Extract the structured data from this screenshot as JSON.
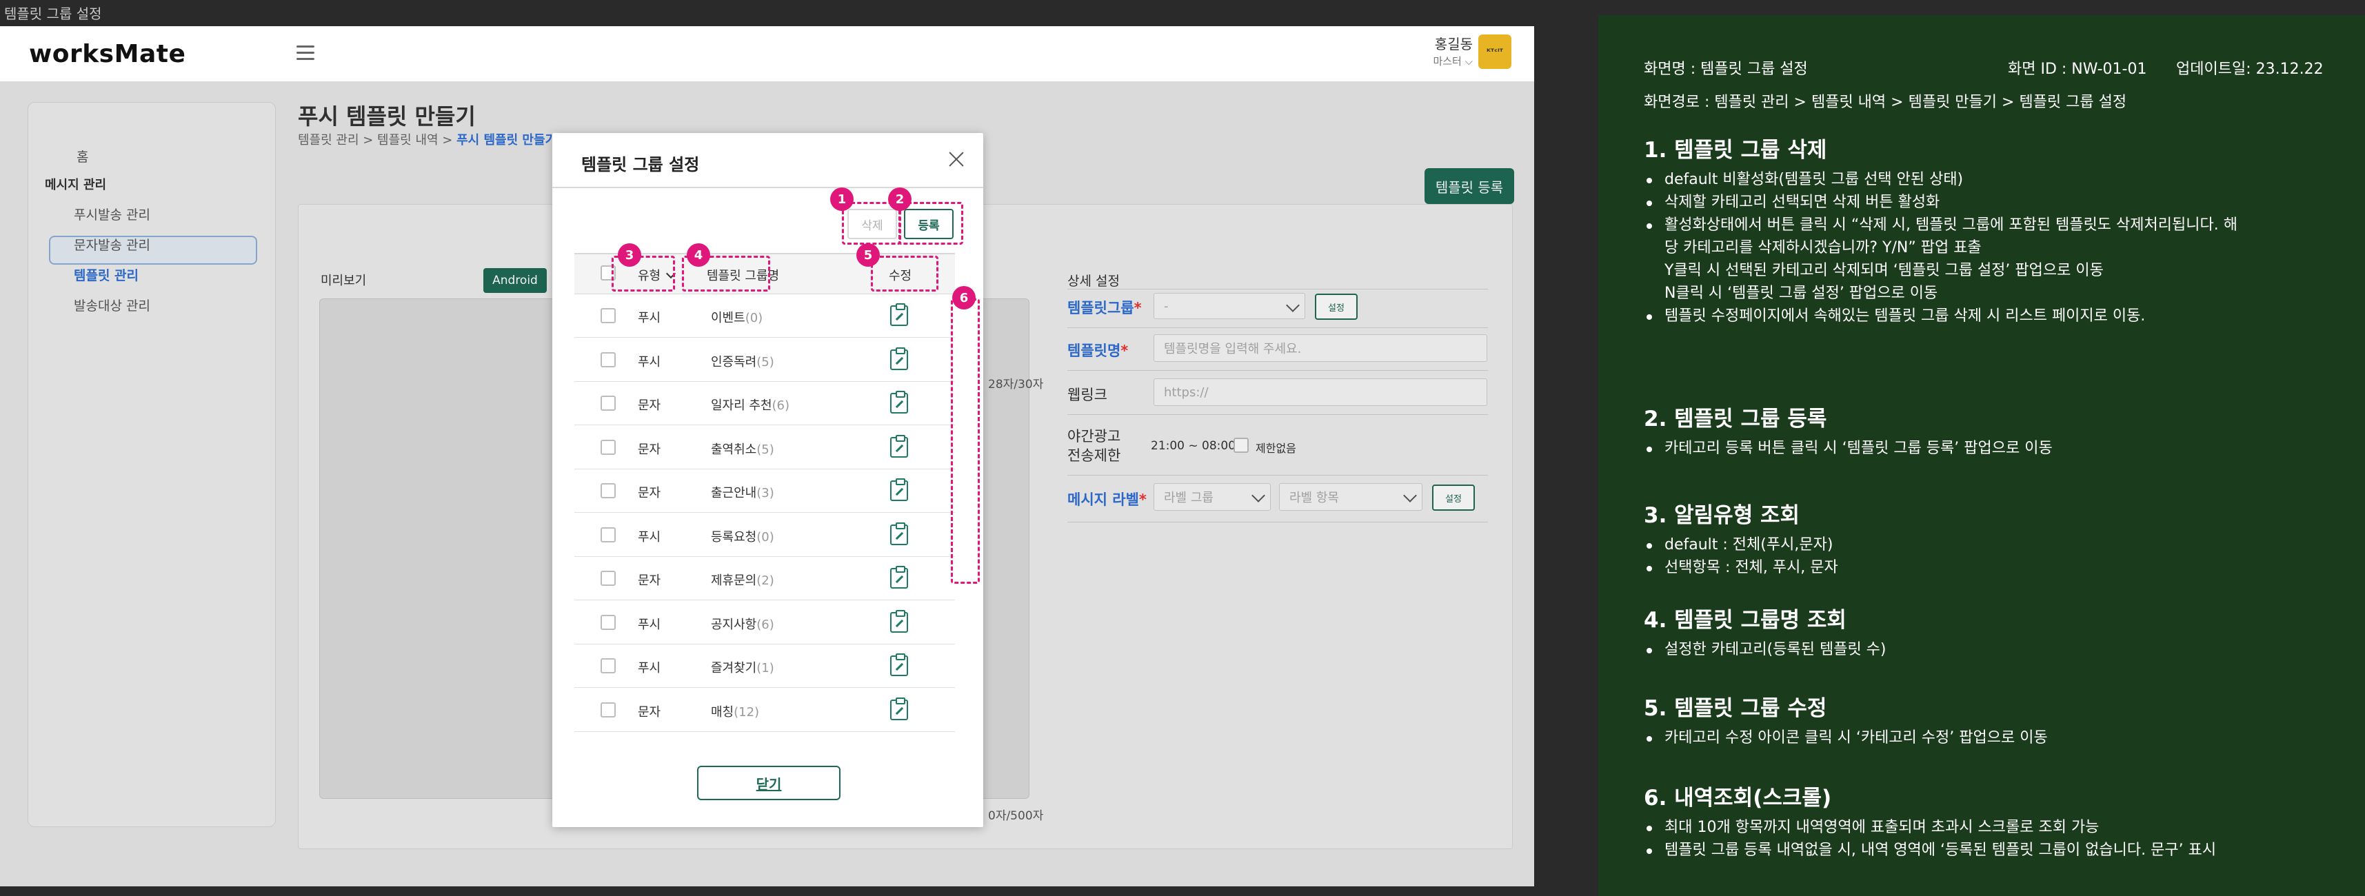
{
  "window_title": "템플릿 그룹 설정",
  "app": {
    "logo": "worksMate",
    "user_name": "홍길동",
    "user_role": "마스터 ⌵",
    "avatar_text": "ᴷᵀᶜᴵᵀ"
  },
  "sidebar": {
    "items": [
      {
        "label": "홈"
      },
      {
        "label": "메시지 관리"
      },
      {
        "label": "푸시발송 관리"
      },
      {
        "label": "문자발송 관리"
      },
      {
        "label": "템플릿 관리"
      },
      {
        "label": "발송대상 관리"
      }
    ]
  },
  "page": {
    "title": "푸시 템플릿 만들기",
    "breadcrumb": "템플릿 관리 > 템플릿 내역 > ",
    "breadcrumb_current": "푸시 템플릿 만들기",
    "register_button": "템플릿 등록",
    "preview_label": "미리보기",
    "tab_android": "Android",
    "counter_title": "28자/30자",
    "counter_body": "0자/500자",
    "detail_label": "상세 설정",
    "group_label": "템플릿그룹",
    "group_select": "-",
    "group_set_button": "설정",
    "name_label": "템플릿명",
    "name_placeholder": "템플릿명을 입력해 주세요.",
    "weblink_label": "웹링크",
    "weblink_placeholder": "https://",
    "night_label_1": "야간광고",
    "night_label_2": "전송제한",
    "night_time": "21:00 ~ 08:00",
    "night_unlimited": "제한없음",
    "msg_label": "메시지 라벨",
    "label_group_placeholder": "라벨 그룹",
    "label_item_placeholder": "라벨 항목",
    "label_set_button": "설정",
    "required_mark": "*"
  },
  "modal": {
    "title": "템플릿 그룹 설정",
    "delete_button": "삭제",
    "add_button": "등록",
    "col_type": "유형",
    "col_name": "템플릿 그룹명",
    "col_edit": "수정",
    "rows": [
      {
        "type": "푸시",
        "name": "이벤트",
        "count": "(0)"
      },
      {
        "type": "푸시",
        "name": "인증독려",
        "count": "(5)"
      },
      {
        "type": "문자",
        "name": "일자리 추천",
        "count": "(6)"
      },
      {
        "type": "문자",
        "name": "출역취소",
        "count": "(5)"
      },
      {
        "type": "문자",
        "name": "출근안내",
        "count": "(3)"
      },
      {
        "type": "푸시",
        "name": "등록요청",
        "count": "(0)"
      },
      {
        "type": "문자",
        "name": "제휴문의",
        "count": "(2)"
      },
      {
        "type": "푸시",
        "name": "공지사항",
        "count": "(6)"
      },
      {
        "type": "푸시",
        "name": "즐겨찾기",
        "count": "(1)"
      },
      {
        "type": "문자",
        "name": "매칭",
        "count": "(12)"
      }
    ],
    "close_button": "닫기"
  },
  "annotations": [
    "1",
    "2",
    "3",
    "4",
    "5",
    "6"
  ],
  "spec": {
    "screen_name": "화면명 : 템플릿 그룹 설정",
    "screen_id": "화면 ID :  NW-01-01",
    "updated": "업데이트일: 23.12.22",
    "path": "화면경로 : 템플릿 관리 > 템플릿 내역 > 템플릿 만들기 > 템플릿 그룹 설정",
    "sections": [
      {
        "heading": "1. 템플릿 그룹 삭제",
        "lines": [
          {
            "text": "default 비활성화(템플릿 그룹 선택 안된 상태)",
            "bullet": true
          },
          {
            "text": "삭제할 카테고리 선택되면 삭제 버튼 활성화",
            "bullet": true
          },
          {
            "text": "활성화상태에서 버튼 클릭 시 “삭제 시, 템플릿 그룹에 포함된 템플릿도 삭제처리됩니다. 해",
            "bullet": true
          },
          {
            "text": "당 카테고리를 삭제하시겠습니까?  Y/N” 팝업 표출",
            "bullet": false
          },
          {
            "text": "Y클릭 시 선택된 카테고리 삭제되며 ‘템플릿 그룹 설정’ 팝업으로 이동",
            "bullet": false
          },
          {
            "text": "N클릭 시 ‘템플릿 그룹 설정’ 팝업으로 이동",
            "bullet": false
          },
          {
            "text": "템플릿 수정페이지에서 속해있는 템플릿 그룹 삭제 시 리스트 페이지로 이동.",
            "bullet": true
          }
        ]
      },
      {
        "heading": "2. 템플릿 그룹 등록",
        "lines": [
          {
            "text": "카테고리 등록 버튼 클릭 시 ‘템플릿 그룹 등록’ 팝업으로 이동",
            "bullet": true
          }
        ]
      },
      {
        "heading": "3. 알림유형 조회",
        "lines": [
          {
            "text": "default : 전체(푸시,문자)",
            "bullet": true
          },
          {
            "text": "선택항목 : 전체, 푸시, 문자",
            "bullet": true
          }
        ]
      },
      {
        "heading": "4. 템플릿 그룹명 조회",
        "lines": [
          {
            "text": "설정한 카테고리(등록된 템플릿 수)",
            "bullet": true
          }
        ]
      },
      {
        "heading": "5. 템플릿 그룹 수정",
        "lines": [
          {
            "text": "카테고리 수정 아이콘 클릭 시 ‘카테고리 수정’ 팝업으로 이동",
            "bullet": true
          }
        ]
      },
      {
        "heading": "6. 내역조회(스크롤)",
        "lines": [
          {
            "text": "최대 10개 항목까지 내역영역에 표출되며 초과시 스크롤로 조회 가능",
            "bullet": true
          },
          {
            "text": "템플릿 그룹 등록 내역없을 시, 내역 영역에 ‘등록된 템플릿 그룹이 없습니다. 문구’ 표시",
            "bullet": true
          }
        ]
      }
    ]
  }
}
